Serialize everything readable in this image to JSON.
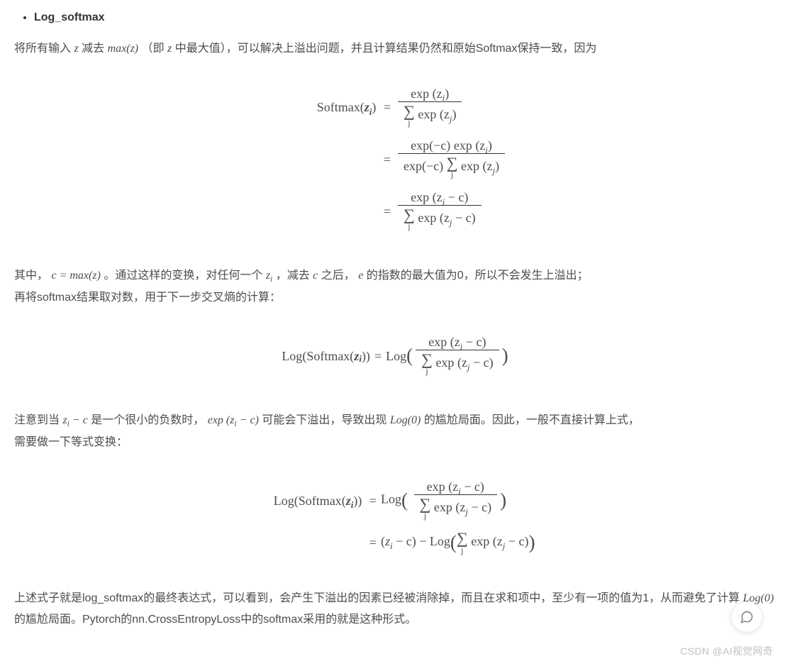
{
  "heading": "Log_softmax",
  "p1_a": "将所有输入 ",
  "p1_b": " 减去 ",
  "p1_c": " （即 ",
  "p1_d": " 中最大值），可以解决上溢出问题，并且计算结果仍然和原始Softmax保持一致，因为",
  "z": "z",
  "max_z": "max(z)",
  "softmax_label": "Softmax(",
  "zi_bold": "z",
  "zi_sub": "i",
  "close_paren": ")",
  "eq": " = ",
  "exp": "exp",
  "Log": "Log",
  "paren_zi": "(z",
  "paren_close": ")",
  "paren_mc": "(−c)",
  "paren_zi_mc": "(z",
  "sub_i": "i",
  "sub_j": "j",
  "mc_close": " − c)",
  "sum_j": "j",
  "p2_a": "其中，",
  "p2_b": "c = max(z)",
  "p2_c": "。通过这样的变换，对任何一个 ",
  "p2_d": "z",
  "p2_e": "，减去 ",
  "p2_f": "c",
  "p2_g": " 之后，",
  "p2_h": "e",
  "p2_i": " 的指数的最大值为0，所以不会发生上溢出；",
  "p2_line2": "再将softmax结果取对数，用于下一步交叉熵的计算：",
  "p3_a": "注意到当 ",
  "p3_b": "z",
  "p3_c": " − c",
  "p3_d": " 是一个很小的负数时，",
  "p3_e": "exp (z",
  "p3_f": " − c)",
  "p3_g": " 可能会下溢出，导致出现 ",
  "p3_h": "Log(0)",
  "p3_i": " 的尴尬局面。因此，一般不直接计算上式，",
  "p3_line2": "需要做一下等式变换：",
  "p4_a": "上述式子就是log_softmax的最终表达式，可以看到，会产生下溢出的因素已经被消除掉，而且在求和项中，至少有一项的值为1，从而避免了计算 ",
  "p4_b": "Log(0)",
  "p4_c": " 的尴尬局面。Pytorch的nn.CrossEntropyLoss中的softmax采用的就是这种形式。",
  "minus": " − ",
  "watermark": "CSDN @AI视觉网奇"
}
